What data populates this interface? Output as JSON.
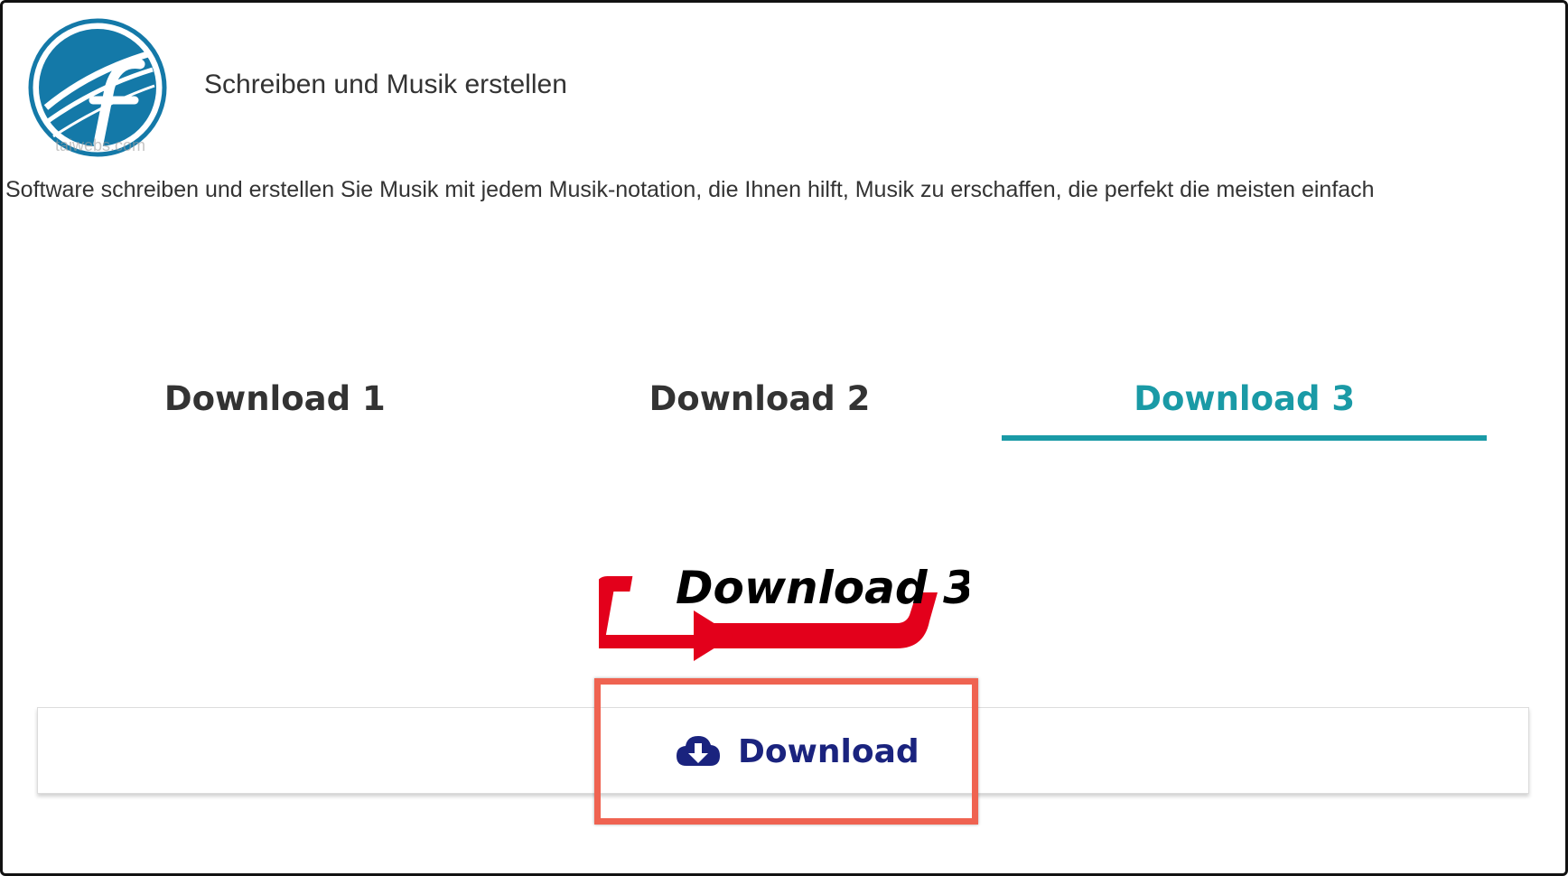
{
  "header": {
    "logo_icon": "site-logo-icon",
    "logo_watermark": "taiwebs.com",
    "title": "Schreiben und Musik erstellen"
  },
  "intro": {
    "text": "Software schreiben und erstellen Sie Musik mit jedem Musik-notation, die Ihnen hilft, Musik zu erschaffen, die perfekt die meisten einfach"
  },
  "tabs": [
    {
      "label": "Download 1",
      "active": false
    },
    {
      "label": "Download 2",
      "active": false
    },
    {
      "label": "Download 3",
      "active": true
    }
  ],
  "download_section": {
    "banner_text": "Download 3",
    "button_label": "Download",
    "button_icon": "cloud-download-icon"
  },
  "colors": {
    "accent_teal": "#1a9aa6",
    "button_text": "#1a237e",
    "banner_red": "#e3001b",
    "highlight_border": "#ef6351",
    "logo_blue": "#1479a8"
  }
}
